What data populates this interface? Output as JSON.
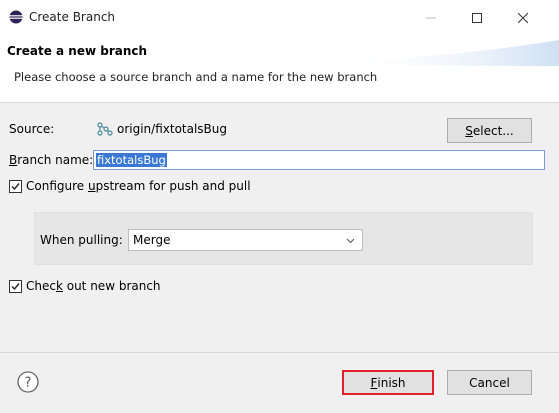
{
  "window": {
    "title": "Create Branch",
    "minimize_glyph": "—",
    "maximize_glyph": "☐",
    "close_glyph": "✕"
  },
  "header": {
    "title": "Create a new branch",
    "description": "Please choose a source branch and a name for the new branch"
  },
  "form": {
    "source_label": "Source:",
    "source_value": "origin/fixtotalsBug",
    "source_icon": "remote-branch-icon",
    "select_button_mnemonic": "S",
    "select_button_rest": "elect...",
    "branch_name_label_mnemonic": "B",
    "branch_name_label_rest": "ranch name:",
    "branch_name_value": "fixtotalsBug",
    "configure_upstream_pre": "Configure ",
    "configure_upstream_mnemonic": "u",
    "configure_upstream_post": "pstream for push and pull",
    "configure_upstream_checked": true,
    "when_pulling_label": "When pulling:",
    "when_pulling_value": "Merge",
    "checkout_pre": "Chec",
    "checkout_mnemonic": "k",
    "checkout_post": " out new branch",
    "checkout_checked": true
  },
  "footer": {
    "help_icon": "help-icon",
    "finish_mnemonic": "F",
    "finish_rest": "inish",
    "cancel_label": "Cancel"
  },
  "colors": {
    "highlight_border": "#e0202a",
    "selection": "#3a78d4",
    "input_focus_border": "#7a9cd3"
  }
}
